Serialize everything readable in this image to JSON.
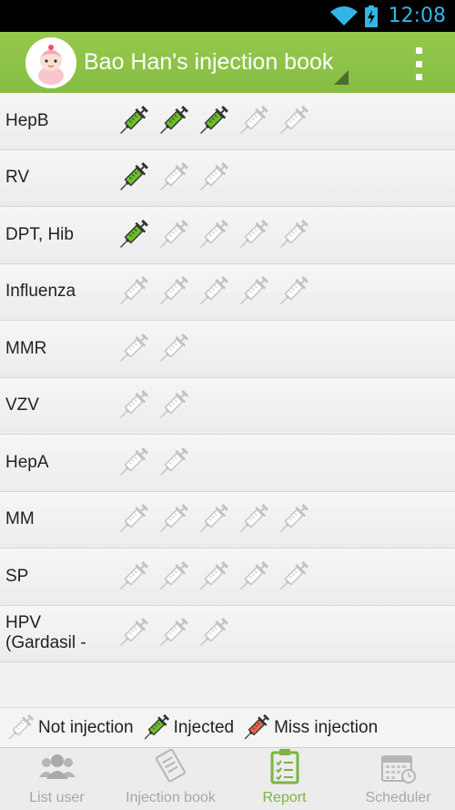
{
  "status_bar": {
    "time": "12:08"
  },
  "app_bar": {
    "title": "Bao Han's injection book"
  },
  "colors": {
    "injected": "#6bbf2a",
    "not_injected": "#d4d4d4",
    "missed": "#e8634e",
    "accent": "#8bc34a"
  },
  "vaccines": [
    {
      "label": "HepB",
      "doses": [
        "injected",
        "injected",
        "injected",
        "not",
        "not"
      ]
    },
    {
      "label": "RV",
      "doses": [
        "injected",
        "not",
        "not"
      ]
    },
    {
      "label": "DPT, Hib",
      "doses": [
        "injected",
        "not",
        "not",
        "not",
        "not"
      ]
    },
    {
      "label": "Influenza",
      "doses": [
        "not",
        "not",
        "not",
        "not",
        "not"
      ]
    },
    {
      "label": "MMR",
      "doses": [
        "not",
        "not"
      ]
    },
    {
      "label": "VZV",
      "doses": [
        "not",
        "not"
      ]
    },
    {
      "label": "HepA",
      "doses": [
        "not",
        "not"
      ]
    },
    {
      "label": "MM",
      "doses": [
        "not",
        "not",
        "not",
        "not",
        "not"
      ]
    },
    {
      "label": "SP",
      "doses": [
        "not",
        "not",
        "not",
        "not",
        "not"
      ]
    },
    {
      "label": "HPV\n(Gardasil -",
      "doses": [
        "not",
        "not",
        "not"
      ]
    }
  ],
  "legend": {
    "not_injection": "Not injection",
    "injected": "Injected",
    "miss_injection": "Miss injection"
  },
  "nav": {
    "list_user": "List user",
    "injection_book": "Injection book",
    "report": "Report",
    "scheduler": "Scheduler",
    "active": "report"
  }
}
